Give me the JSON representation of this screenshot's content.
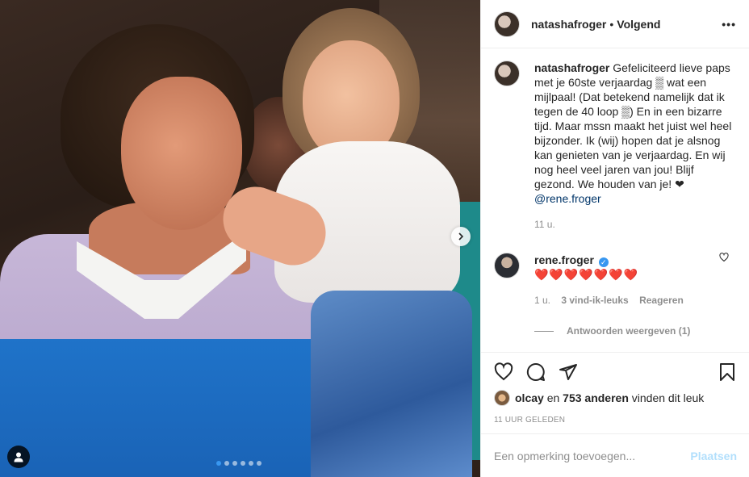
{
  "header": {
    "username": "natashafroger",
    "separator": "•",
    "follow_label": "Volgend",
    "more_label": "•••"
  },
  "caption": {
    "username": "natashafroger",
    "text": "Gefeliciteerd lieve paps met je 60ste verjaardag ▒ wat een mijlpaal! (Dat betekend namelijk dat ik tegen de 40 loop ▒) En in een bizarre tijd. Maar mssn maakt het juist wel heel bijzonder. Ik (wij) hopen dat je alsnog kan genieten van je verjaardag. En wij nog heel veel jaren van jou! Blijf gezond. We houden van je! ❤",
    "mention": "@rene.froger",
    "time": "11 u."
  },
  "comment": {
    "username": "rene.froger",
    "verified_mark": "✓",
    "text": "❤️❤️❤️❤️❤️❤️❤️",
    "time": "1 u.",
    "likes": "3 vind-ik-leuks",
    "reply_label": "Reageren",
    "view_replies": "Antwoorden weergeven (1)"
  },
  "likes_line": {
    "user": "olcay",
    "connector": "en",
    "others": "753 anderen",
    "suffix": "vinden dit leuk"
  },
  "timestamp": "11 UUR GELEDEN",
  "add_comment": {
    "placeholder": "Een opmerking toevoegen...",
    "post_label": "Plaatsen"
  },
  "carousel": {
    "slides": 6,
    "active": 1
  },
  "icons": [
    "more-icon",
    "heart-icon",
    "comment-icon",
    "share-icon",
    "save-icon",
    "chevron-right-icon",
    "user-tag-icon",
    "heart-small-icon"
  ],
  "colors": {
    "link": "#003569",
    "muted": "#8e8e8e",
    "active_dot": "#3897f0",
    "post_button": "#b2dffc",
    "verified": "#3897f0"
  }
}
